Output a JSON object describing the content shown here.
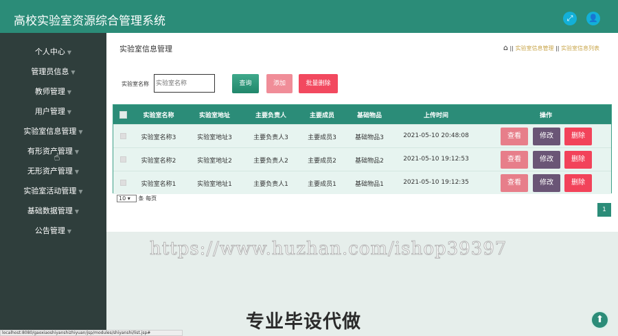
{
  "header": {
    "title": "高校实验室资源综合管理系统"
  },
  "sidebar": {
    "items": [
      {
        "label": "个人中心"
      },
      {
        "label": "管理员信息"
      },
      {
        "label": "教师管理"
      },
      {
        "label": "用户管理"
      },
      {
        "label": "实验室信息管理"
      },
      {
        "label": "有形资产管理"
      },
      {
        "label": "无形资产管理"
      },
      {
        "label": "实验室活动管理"
      },
      {
        "label": "基础数据管理"
      },
      {
        "label": "公告管理"
      }
    ]
  },
  "page": {
    "title": "实验室信息管理",
    "breadcrumb": {
      "sep": "||",
      "items": [
        "实验室信息管理",
        "实验室信息列表"
      ]
    }
  },
  "search": {
    "label": "实验室名称",
    "placeholder": "实验室名称",
    "query_label": "查询",
    "add_label": "添加",
    "batch_delete_label": "批量删除"
  },
  "table": {
    "headers": [
      "实验室名称",
      "实验室地址",
      "主要负责人",
      "主要成员",
      "基础物品",
      "上传时间",
      "操作"
    ],
    "rows": [
      {
        "name": "实验室名称3",
        "address": "实验室地址3",
        "leader": "主要负责人3",
        "member": "主要成员3",
        "items": "基础物品3",
        "time": "2021-05-10 20:48:08"
      },
      {
        "name": "实验室名称2",
        "address": "实验室地址2",
        "leader": "主要负责人2",
        "member": "主要成员2",
        "items": "基础物品2",
        "time": "2021-05-10 19:12:53"
      },
      {
        "name": "实验室名称1",
        "address": "实验室地址1",
        "leader": "主要负责人1",
        "member": "主要成员1",
        "items": "基础物品1",
        "time": "2021-05-10 19:12:35"
      }
    ],
    "actions": {
      "view": "查看",
      "edit": "修改",
      "delete": "删除"
    }
  },
  "pagination": {
    "page_size": "10",
    "per_page_text": "条 每页",
    "current_page": "1"
  },
  "overlay": {
    "watermark": "https://www.huzhan.com/ishop39397",
    "promo": "专业毕设代做"
  },
  "statusbar": {
    "url": "localhost:8080/gaoxiaoshiyanshizhiyuan/jsp/modules/shiyanshi/list.jsp#"
  },
  "icons": [
    "expand-icon",
    "user-icon",
    "home-icon",
    "scroll-top-icon"
  ],
  "colors": {
    "primary": "#2b8c78",
    "sidebar": "#2f3e3c",
    "view": "#e77e8a",
    "edit": "#6a5576",
    "delete": "#f2435a"
  }
}
